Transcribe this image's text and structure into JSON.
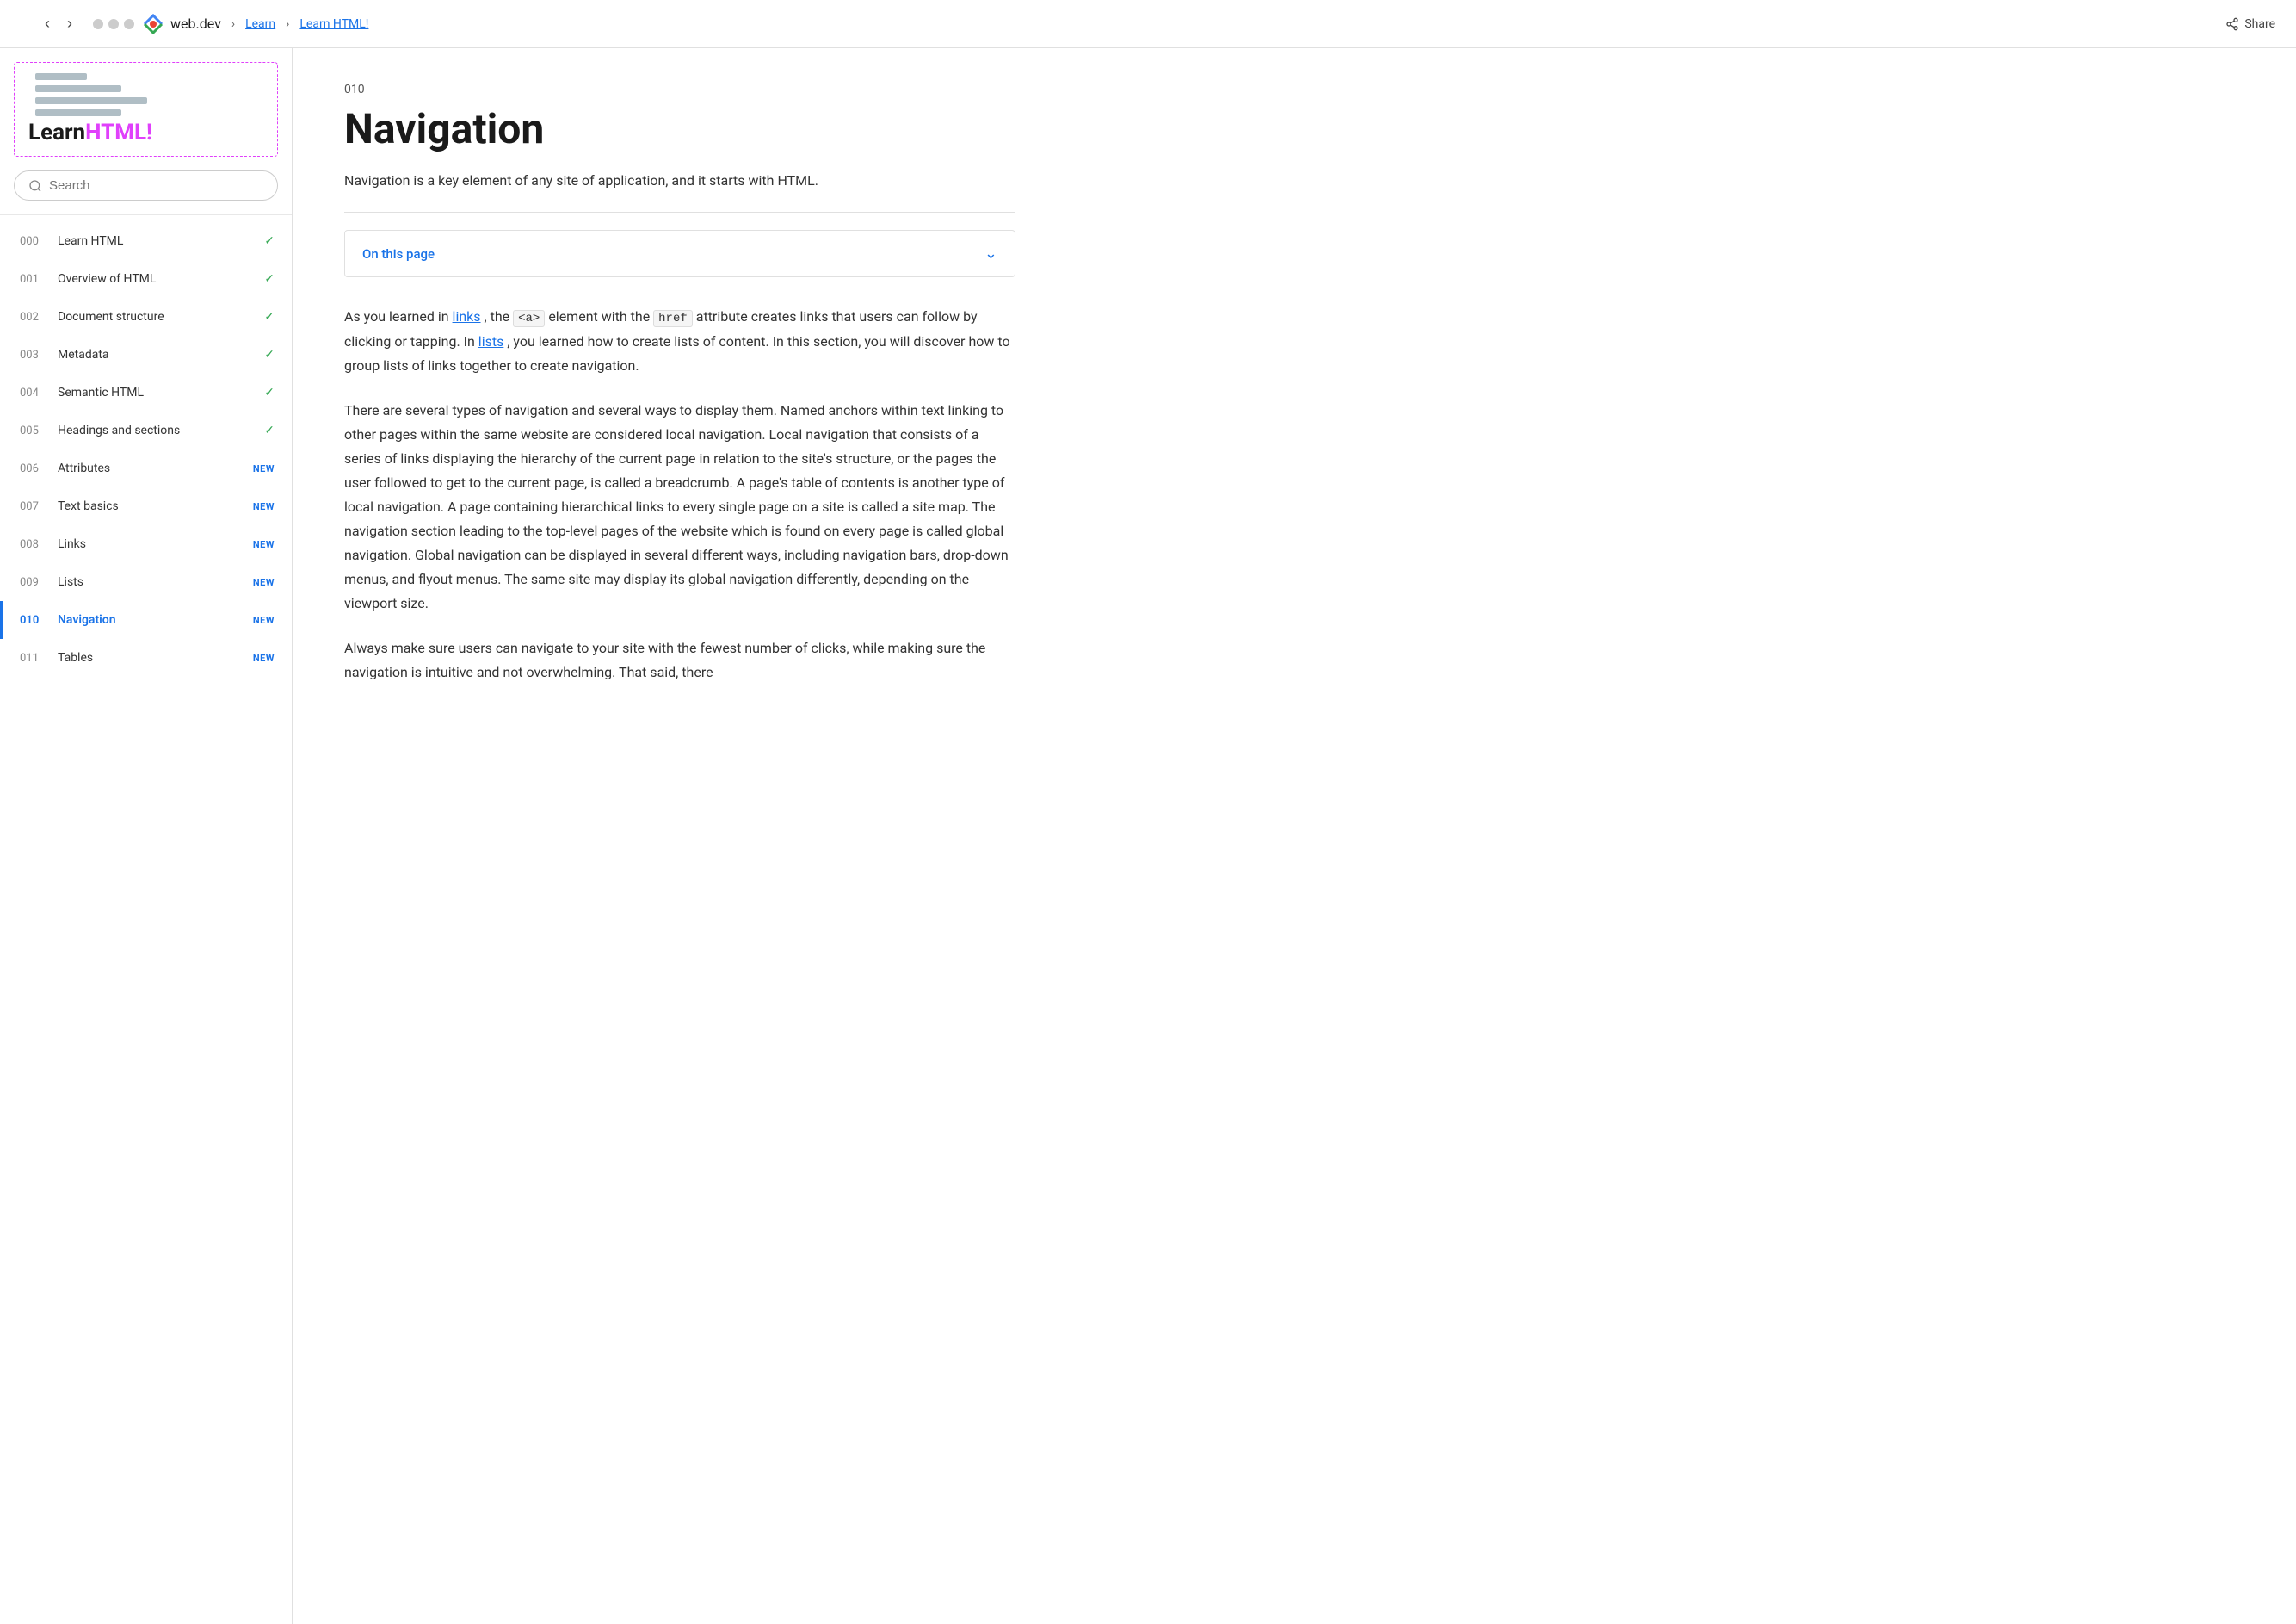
{
  "topnav": {
    "logo_text": "web.dev",
    "breadcrumbs": [
      "Learn",
      "Learn HTML!"
    ],
    "share_label": "Share"
  },
  "sidebar": {
    "title_learn": "Learn",
    "title_html": "HTML!",
    "search_placeholder": "Search",
    "nav_items": [
      {
        "num": "000",
        "label": "Learn HTML",
        "status": "check"
      },
      {
        "num": "001",
        "label": "Overview of HTML",
        "status": "check"
      },
      {
        "num": "002",
        "label": "Document structure",
        "status": "check"
      },
      {
        "num": "003",
        "label": "Metadata",
        "status": "check"
      },
      {
        "num": "004",
        "label": "Semantic HTML",
        "status": "check"
      },
      {
        "num": "005",
        "label": "Headings and sections",
        "status": "check"
      },
      {
        "num": "006",
        "label": "Attributes",
        "status": "new"
      },
      {
        "num": "007",
        "label": "Text basics",
        "status": "new"
      },
      {
        "num": "008",
        "label": "Links",
        "status": "new"
      },
      {
        "num": "009",
        "label": "Lists",
        "status": "new"
      },
      {
        "num": "010",
        "label": "Navigation",
        "status": "new",
        "active": true
      },
      {
        "num": "011",
        "label": "Tables",
        "status": "new"
      }
    ]
  },
  "content": {
    "section_num": "010",
    "title": "Navigation",
    "subtitle": "Navigation is a key element of any site of application, and it starts with HTML.",
    "on_this_page": "On this page",
    "body_p1_prefix": "As you learned in ",
    "body_p1_links_links": "links",
    "body_p1_middle": ", the ",
    "body_p1_code1": "<a>",
    "body_p1_middle2": " element with the ",
    "body_p1_code2": "href",
    "body_p1_middle3": " attribute creates links that users can follow by clicking or tapping. In ",
    "body_p1_links_lists": "lists",
    "body_p1_suffix": ", you learned how to create lists of content. In this section, you will discover how to group lists of links together to create navigation.",
    "body_p2": "There are several types of navigation and several ways to display them. Named anchors within text linking to other pages within the same website are considered local navigation. Local navigation that consists of a series of links displaying the hierarchy of the current page in relation to the site's structure, or the pages the user followed to get to the current page, is called a breadcrumb. A page's table of contents is another type of local navigation. A page containing hierarchical links to every single page on a site is called a site map. The navigation section leading to the top-level pages of the website which is found on every page is called global navigation. Global navigation can be displayed in several different ways, including navigation bars, drop-down menus, and flyout menus. The same site may display its global navigation differently, depending on the viewport size.",
    "body_p3_prefix": "Always make sure users can navigate to your site with the fewest number of clicks, while making sure the navigation is intuitive and not overwhelming. That said, there"
  }
}
